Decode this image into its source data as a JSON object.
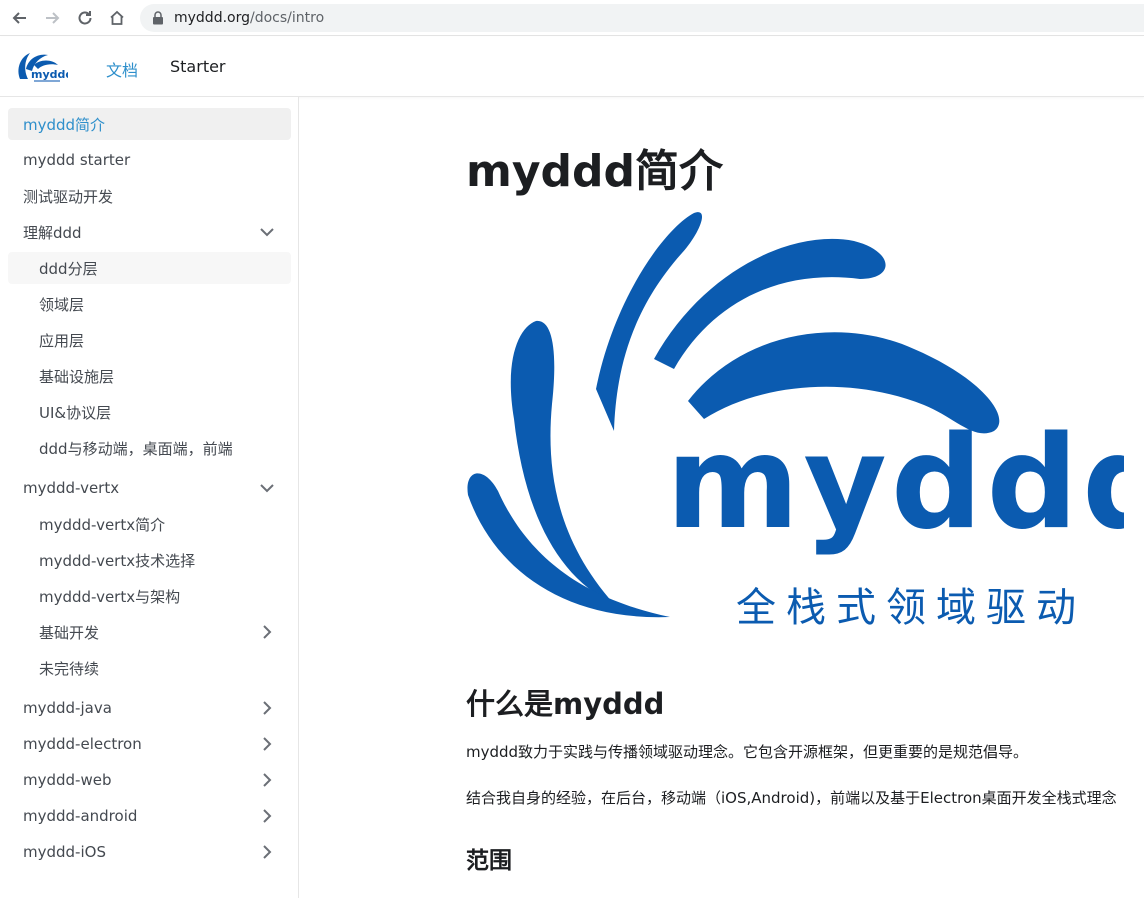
{
  "browser": {
    "url_domain": "myddd.org",
    "url_path": "/docs/intro"
  },
  "navbar": {
    "links": [
      {
        "label": "文档"
      },
      {
        "label": "Starter"
      }
    ]
  },
  "sidebar": {
    "items": [
      {
        "label": "myddd简介"
      },
      {
        "label": "myddd starter"
      },
      {
        "label": "测试驱动开发"
      },
      {
        "label": "理解ddd"
      },
      {
        "label": "ddd分层"
      },
      {
        "label": "领域层"
      },
      {
        "label": "应用层"
      },
      {
        "label": "基础设施层"
      },
      {
        "label": "UI&协议层"
      },
      {
        "label": "ddd与移动端，桌面端，前端"
      },
      {
        "label": "myddd-vertx"
      },
      {
        "label": "myddd-vertx简介"
      },
      {
        "label": "myddd-vertx技术选择"
      },
      {
        "label": "myddd-vertx与架构"
      },
      {
        "label": "基础开发"
      },
      {
        "label": "未完待续"
      },
      {
        "label": "myddd-java"
      },
      {
        "label": "myddd-electron"
      },
      {
        "label": "myddd-web"
      },
      {
        "label": "myddd-android"
      },
      {
        "label": "myddd-iOS"
      }
    ]
  },
  "content": {
    "title": "myddd简介",
    "hero_logo_text": "myddd",
    "hero_logo_subtitle": "全栈式领域驱动",
    "section_heading": "什么是myddd",
    "paragraph1": "myddd致力于实践与传播领域驱动理念。它包含开源框架，但更重要的是规范倡导。",
    "paragraph2": "结合我自身的经验，在后台，移动端（iOS,Android)，前端以及基于Electron桌面开发全栈式理念",
    "subheading": "范围"
  },
  "colors": {
    "accent": "#2e8fcb",
    "logo_blue": "#0b5bb0"
  }
}
